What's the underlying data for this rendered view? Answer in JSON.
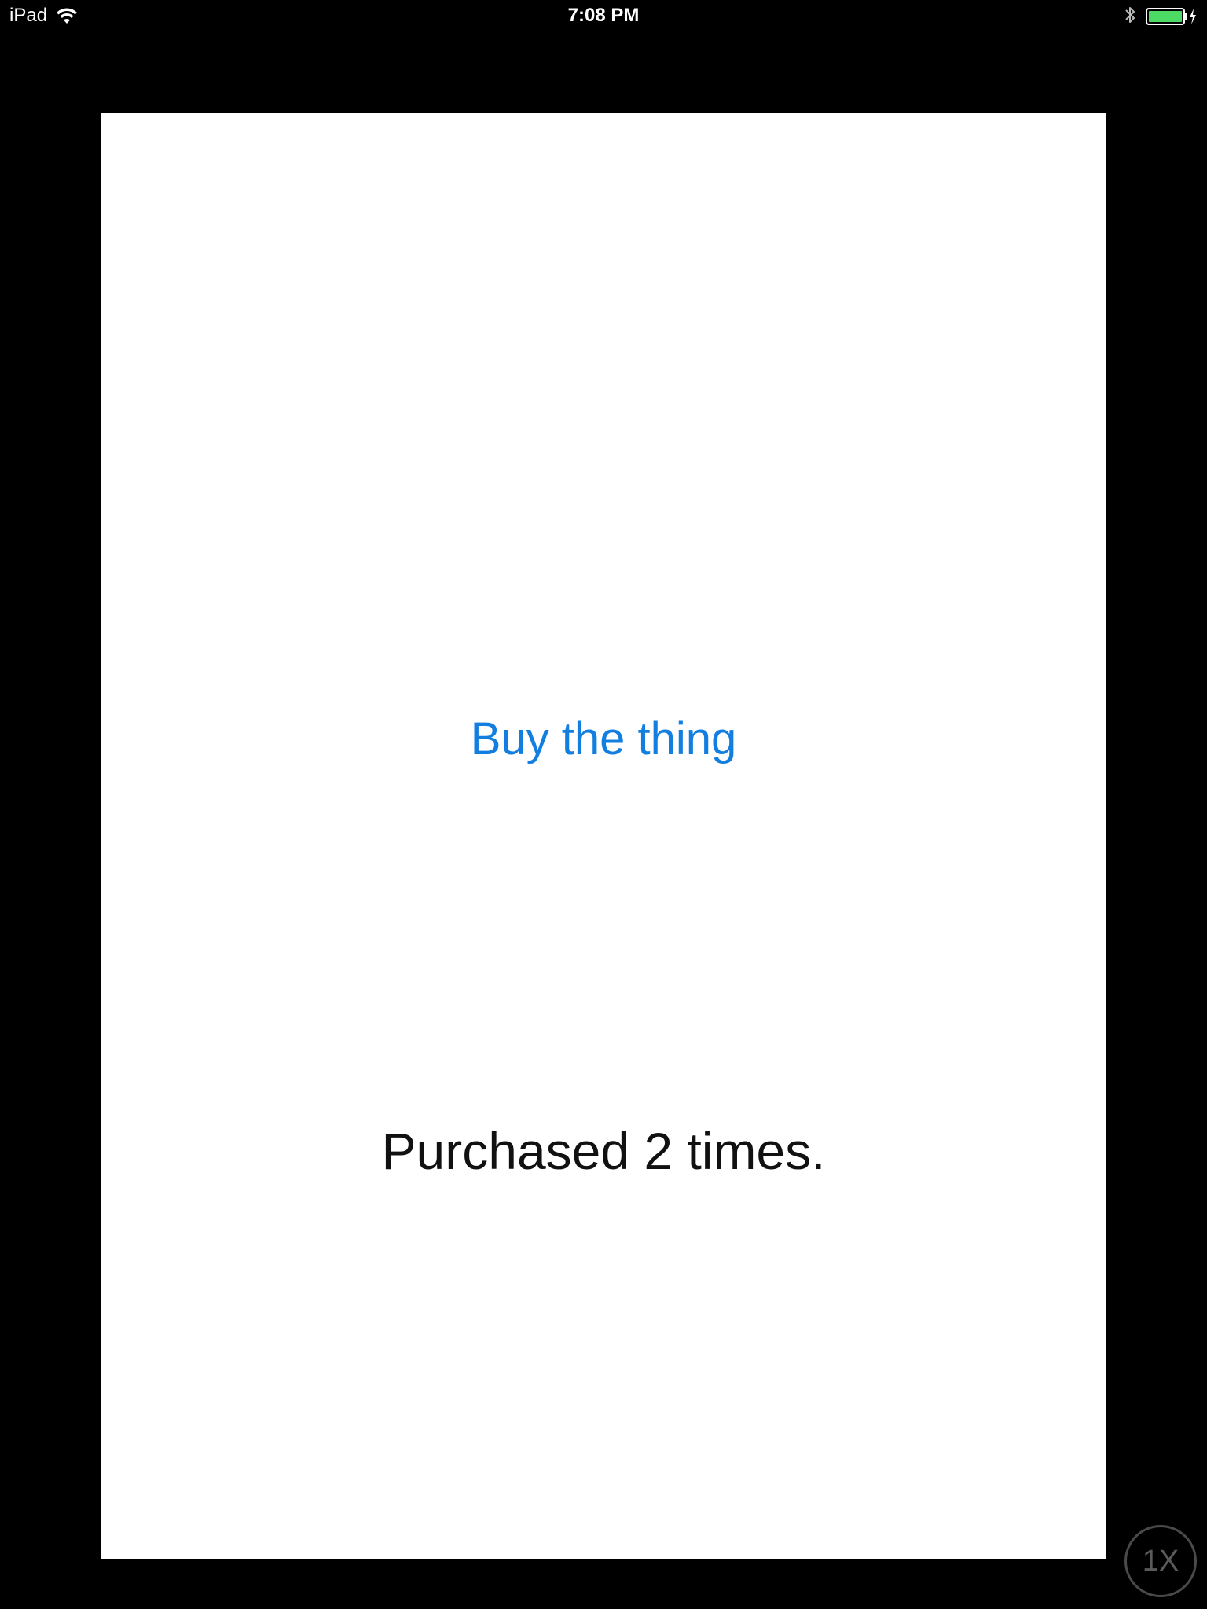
{
  "status_bar": {
    "device": "iPad",
    "time": "7:08 PM",
    "icons": [
      "wifi-icon",
      "bluetooth-icon",
      "battery-charging-icon"
    ],
    "battery_color": "#4cd964"
  },
  "main": {
    "buy_button_label": "Buy the thing",
    "purchase_count_text": "Purchased 2 times.",
    "accent_color": "#127ee0"
  },
  "zoom_badge": {
    "label": "1X"
  }
}
